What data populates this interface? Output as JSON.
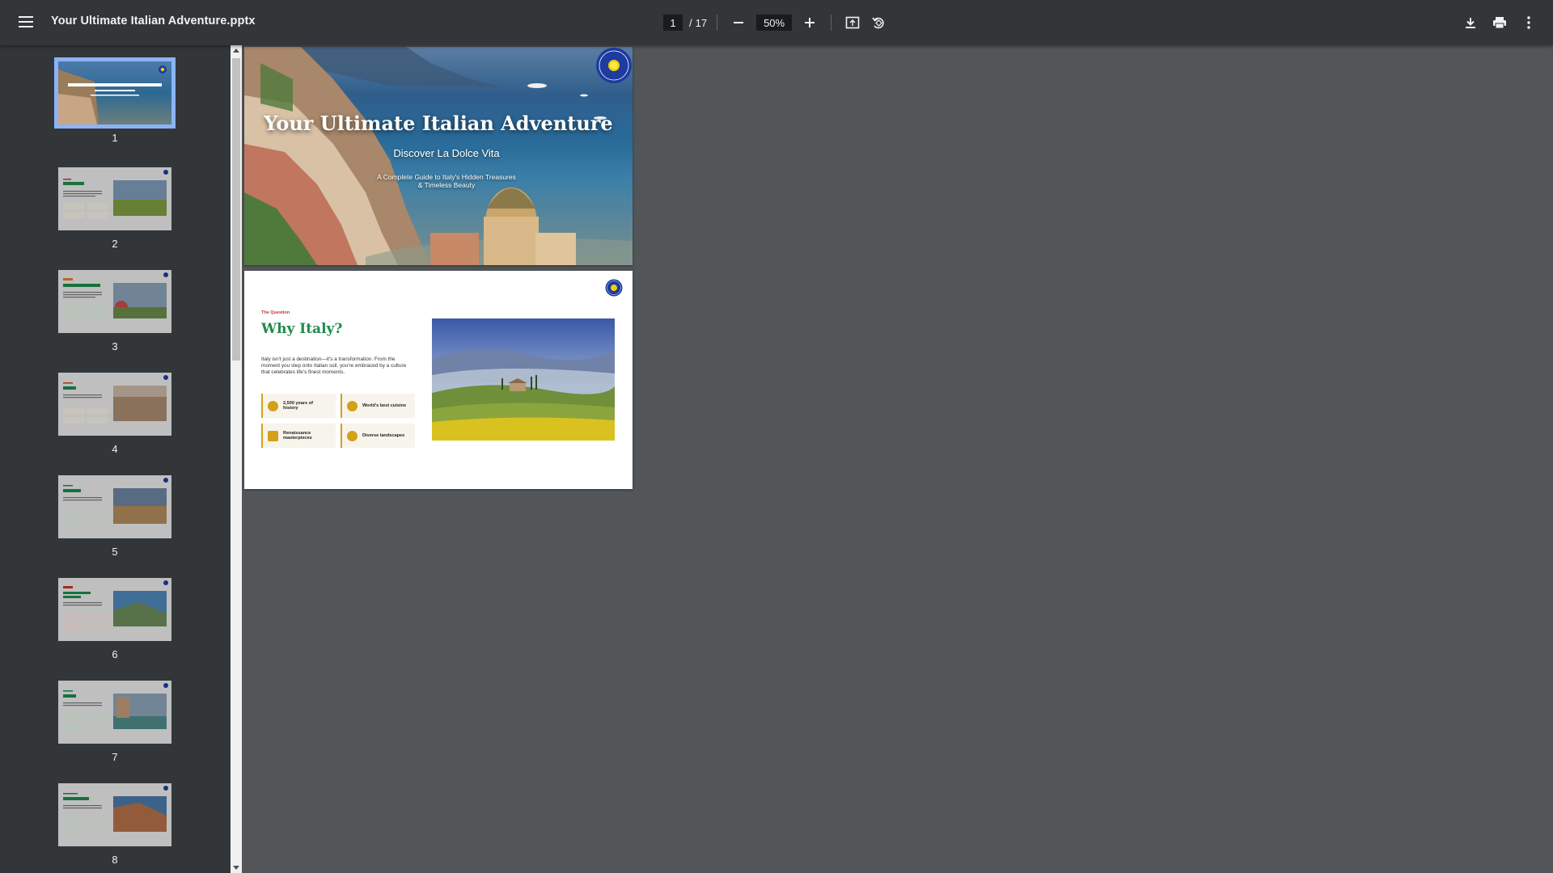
{
  "toolbar": {
    "title": "Your Ultimate Italian Adventure.pptx",
    "current_page": "1",
    "page_separator": "/",
    "total_pages": "17",
    "zoom": "50%",
    "icons": [
      "menu-icon",
      "zoom-out-icon",
      "zoom-in-icon",
      "fit-page-icon",
      "rotate-icon",
      "download-icon",
      "print-icon",
      "more-options-icon"
    ]
  },
  "sidebar": {
    "thumbnails": [
      {
        "number": "1",
        "selected": true
      },
      {
        "number": "2",
        "selected": false
      },
      {
        "number": "3",
        "selected": false
      },
      {
        "number": "4",
        "selected": false
      },
      {
        "number": "5",
        "selected": false
      },
      {
        "number": "6",
        "selected": false
      },
      {
        "number": "7",
        "selected": false
      },
      {
        "number": "8",
        "selected": false
      }
    ]
  },
  "slides": {
    "slide1": {
      "title": "Your Ultimate Italian Adventure",
      "subtitle": "Discover La Dolce Vita",
      "tagline_line1": "A Complete Guide to Italy's Hidden Treasures",
      "tagline_line2": "& Timeless Beauty",
      "logo_text": "ITALY DREAM LIFE"
    },
    "slide2": {
      "eyebrow": "The Question",
      "title": "Why Italy?",
      "body": "Italy isn't just a destination—it's a transformation. From the moment you step onto Italian soil, you're embraced by a culture that celebrates life's finest moments.",
      "cards": [
        {
          "line1": "2,500 years of",
          "line2": "history"
        },
        {
          "line1": "World's best cuisine",
          "line2": ""
        },
        {
          "line1": "Renaissance",
          "line2": "masterpieces"
        },
        {
          "line1": "Diverse landscapes",
          "line2": ""
        }
      ]
    }
  },
  "colors": {
    "toolbar_bg": "#323639",
    "viewer_bg": "#525659",
    "selection_outline": "#8ab4f8",
    "slide2_title": "#1f8a4c",
    "slide2_eyebrow": "#c0392b",
    "card_accent": "#d4a017"
  }
}
